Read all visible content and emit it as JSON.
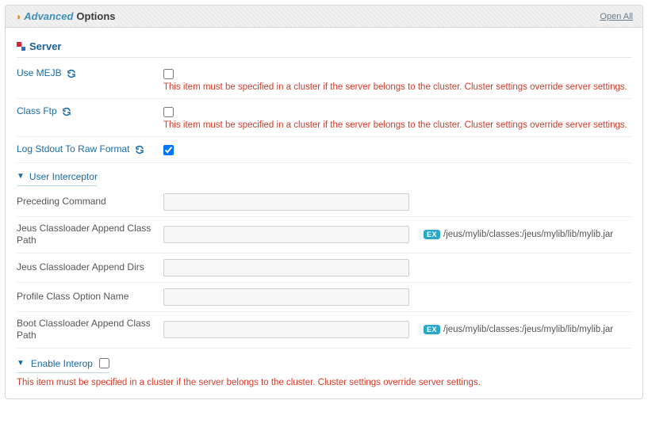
{
  "header": {
    "advanced": "Advanced",
    "options": "Options",
    "open_all": "Open All"
  },
  "section": {
    "server": "Server"
  },
  "rows": {
    "use_mejb": {
      "label": "Use MEJB",
      "checked": false,
      "warn": "This item must be specified in a cluster if the server belongs to the cluster. Cluster settings override server settings."
    },
    "class_ftp": {
      "label": "Class Ftp",
      "checked": false,
      "warn": "This item must be specified in a cluster if the server belongs to the cluster. Cluster settings override server settings."
    },
    "log_stdout": {
      "label": "Log Stdout To Raw Format",
      "checked": true
    }
  },
  "user_interceptor": {
    "title": "User Interceptor",
    "fields": {
      "preceding_command": {
        "label": "Preceding Command",
        "value": ""
      },
      "jeus_append_classpath": {
        "label": "Jeus Classloader Append Class Path",
        "value": "",
        "hint_badge": "EX",
        "hint": "/jeus/mylib/classes:/jeus/mylib/lib/mylib.jar"
      },
      "jeus_append_dirs": {
        "label": "Jeus Classloader Append Dirs",
        "value": ""
      },
      "profile_class_option": {
        "label": "Profile Class Option Name",
        "value": ""
      },
      "boot_append_classpath": {
        "label": "Boot Classloader Append Class Path",
        "value": "",
        "hint_badge": "EX",
        "hint": "/jeus/mylib/classes:/jeus/mylib/lib/mylib.jar"
      }
    }
  },
  "enable_interop": {
    "title": "Enable Interop",
    "checked": false,
    "warn": "This item must be specified in a cluster if the server belongs to the cluster. Cluster settings override server settings."
  }
}
